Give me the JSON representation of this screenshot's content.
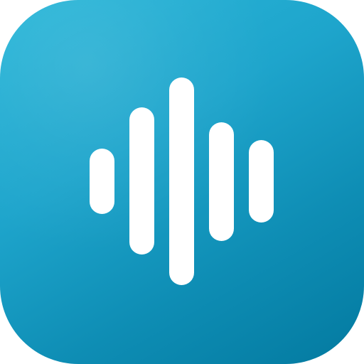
{
  "icon": {
    "name": "audio-waveform-icon",
    "background_colors": [
      "#2bb7d9",
      "#0e8db4",
      "#037aa0"
    ],
    "bar_color": "#ffffff",
    "bars": [
      {
        "name": "waveform-bar-1"
      },
      {
        "name": "waveform-bar-2"
      },
      {
        "name": "waveform-bar-3"
      },
      {
        "name": "waveform-bar-4"
      },
      {
        "name": "waveform-bar-5"
      }
    ]
  }
}
